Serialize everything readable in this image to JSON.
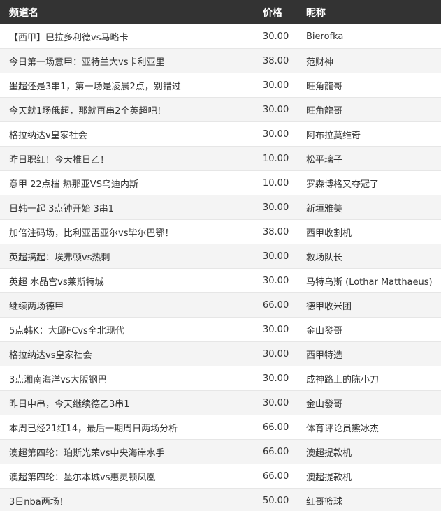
{
  "header": {
    "channel": "频道名",
    "price": "价格",
    "nickname": "昵称"
  },
  "rows": [
    {
      "channel": "【西甲】巴拉多利德vs马略卡",
      "price": "30.00",
      "nickname": "Bierofka"
    },
    {
      "channel": "今日第一场意甲：亚特兰大vs卡利亚里",
      "price": "38.00",
      "nickname": "范财神"
    },
    {
      "channel": "墨超还是3串1，第一场是凌晨2点，别错过",
      "price": "30.00",
      "nickname": "旺角龍哥"
    },
    {
      "channel": "今天就1场俄超，那就再串2个英超吧！",
      "price": "30.00",
      "nickname": "旺角龍哥"
    },
    {
      "channel": "格拉纳达v皇家社会",
      "price": "30.00",
      "nickname": "阿布拉莫维奇"
    },
    {
      "channel": "昨日职红！今天推日乙！",
      "price": "10.00",
      "nickname": "松平璃子"
    },
    {
      "channel": "意甲 22点档 热那亚VS乌迪内斯",
      "price": "10.00",
      "nickname": "罗森博格又夺冠了"
    },
    {
      "channel": "日韩一起 3点钟开始 3串1",
      "price": "30.00",
      "nickname": "新垣雅美"
    },
    {
      "channel": "加倍注码场，比利亚雷亚尔vs毕尔巴鄂！",
      "price": "38.00",
      "nickname": "西甲收割机"
    },
    {
      "channel": "英超搞起：埃弗顿vs热刺",
      "price": "30.00",
      "nickname": "救场队长"
    },
    {
      "channel": "英超 水晶宫vs莱斯特城",
      "price": "30.00",
      "nickname": "马特乌斯 (Lothar Matthaeus)"
    },
    {
      "channel": "继续两场德甲",
      "price": "66.00",
      "nickname": "德甲收米团"
    },
    {
      "channel": "5点韩K：大邱FCvs全北现代",
      "price": "30.00",
      "nickname": "金山發哥"
    },
    {
      "channel": "格拉纳达vs皇家社会",
      "price": "30.00",
      "nickname": "西甲特选"
    },
    {
      "channel": "3点湘南海洋vs大阪钢巴",
      "price": "30.00",
      "nickname": "成神路上的陈小刀"
    },
    {
      "channel": "昨日中串，今天继续德乙3串1",
      "price": "30.00",
      "nickname": "金山發哥"
    },
    {
      "channel": "本周已经21红14，最后一期周日两场分析",
      "price": "66.00",
      "nickname": "体育评论员熊冰杰"
    },
    {
      "channel": "澳超第四轮：珀斯光荣vs中央海岸水手",
      "price": "66.00",
      "nickname": "澳超提款机"
    },
    {
      "channel": "澳超第四轮：墨尔本城vs惠灵顿凤凰",
      "price": "66.00",
      "nickname": "澳超提款机"
    },
    {
      "channel": "3日nba两场！",
      "price": "50.00",
      "nickname": "红哥篮球"
    }
  ]
}
